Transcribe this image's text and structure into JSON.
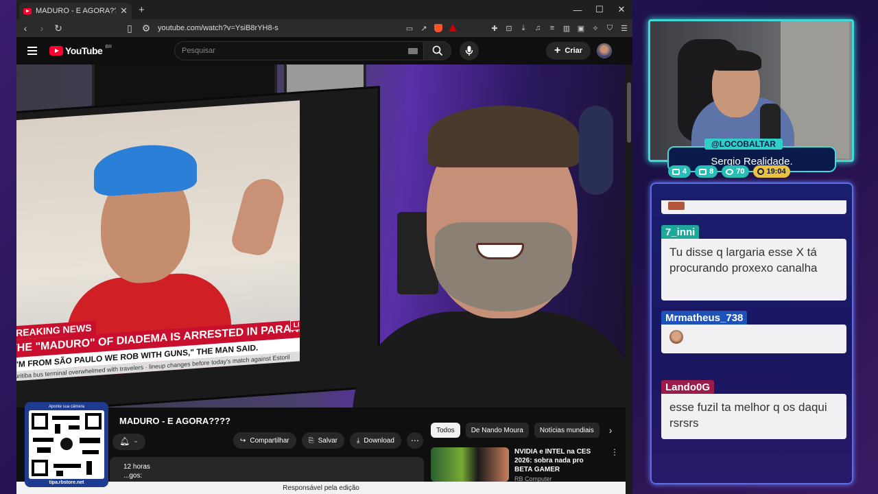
{
  "browser": {
    "tab_title": "MADURO - E AGORA???? - YouTube",
    "url": "youtube.com/watch?v=YsiB8rYH8-s"
  },
  "youtube": {
    "logo_text": "YouTube",
    "country": "BR",
    "search_placeholder": "Pesquisar",
    "create_label": "Criar",
    "video_title": "MADURO - E AGORA????",
    "actions": {
      "share": "Compartilhar",
      "save": "Salvar",
      "download": "Download"
    },
    "description": {
      "line1": "12 horas",
      "line2": "...gos:"
    },
    "chips": [
      "Todos",
      "De Nando Moura",
      "Notícias mundiais"
    ],
    "recommended": {
      "title": "NVIDIA e INTEL na CES 2026: sobra nada pro BETA GAMER",
      "channel": "RB Computer"
    },
    "status_bar": "Responsável pela edição"
  },
  "news_overlay": {
    "label": "BREAKING NEWS",
    "headline": "THE \"MADURO\" OF DIADEMA IS ARRESTED IN PARANÁ.",
    "live": "LIVE",
    "quote": "\"I'M FROM SÃO PAULO WE ROB WITH GUNS,\" THE MAN SAID.",
    "ticker": "Curitiba bus terminal overwhelmed with travelers · lineup changes before today's match against Estoril"
  },
  "qr": {
    "top_text": "Aponte sua câmera",
    "bottom_text": "tipa.rbstore.net"
  },
  "stream": {
    "handle": "@LOCOBALTAR",
    "name": "Sergio Realidade.",
    "stats": {
      "twitch": "4",
      "youtube": "8",
      "kick": "70",
      "time": "19:04"
    },
    "accent": "#3ddad7"
  },
  "chat": [
    {
      "user": "7_inni",
      "user_color": "#1fa89a",
      "text_color": "#ffffff",
      "message": "Tu disse q largaria esse X tá procurando proxexo canalha"
    },
    {
      "user": "Mrmatheus_738",
      "user_color": "#1f52b8",
      "text_color": "#ffffff",
      "message": ""
    },
    {
      "user": "Lando0G",
      "user_color": "#9b1b4a",
      "text_color": "#ffffff",
      "message": "esse fuzil ta melhor q os daqui rsrsrs"
    }
  ]
}
